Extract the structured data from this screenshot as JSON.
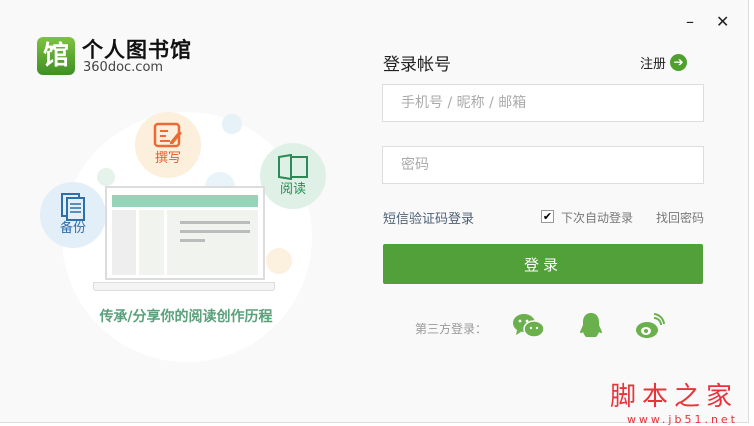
{
  "brand": {
    "logo_char": "馆",
    "title": "个人图书馆",
    "domain": "360doc.com"
  },
  "illustration": {
    "features": [
      "撰写",
      "阅读",
      "备份"
    ],
    "tagline": "传承/分享你的阅读创作历程"
  },
  "window": {
    "minimize": "–",
    "close": "✕"
  },
  "login": {
    "heading": "登录帐号",
    "register": "注册",
    "account_placeholder": "手机号 / 昵称 / 邮箱",
    "password_placeholder": "密码",
    "sms_login": "短信验证码登录",
    "auto_login": "下次自动登录",
    "auto_login_checked": true,
    "forgot": "找回密码",
    "submit": "登录",
    "third_party_label": "第三方登录："
  },
  "watermark": {
    "text": "脚本之家",
    "url": "www.jb51.net"
  },
  "colors": {
    "accent": "#52a03a",
    "tagline": "#5aa07a"
  }
}
